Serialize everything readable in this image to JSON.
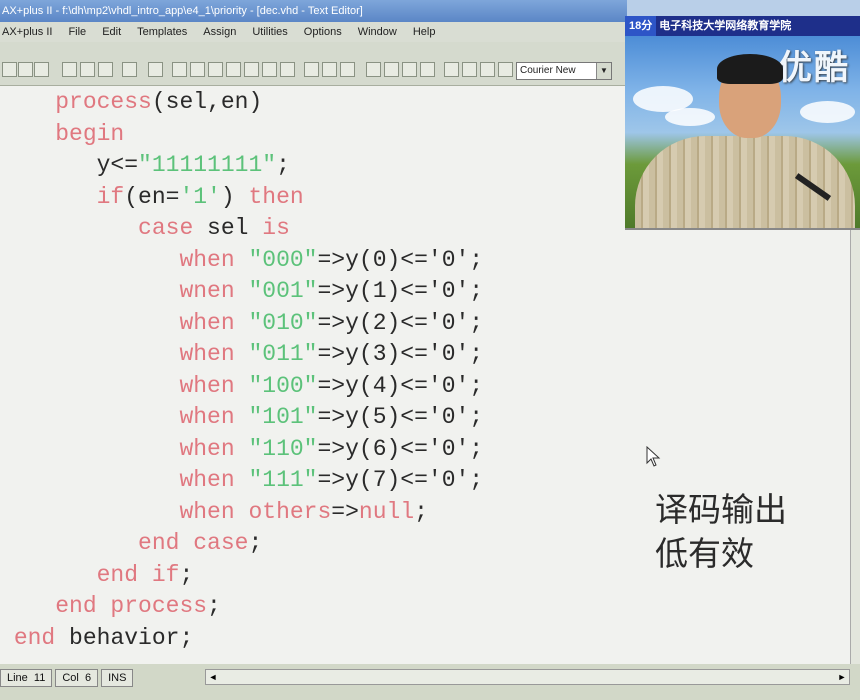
{
  "window": {
    "title": "AX+plus II - f:\\dh\\mp2\\vhdl_intro_app\\e4_1\\priority - [dec.vhd - Text Editor]"
  },
  "menu": {
    "items": [
      "AX+plus II",
      "File",
      "Edit",
      "Templates",
      "Assign",
      "Utilities",
      "Options",
      "Window",
      "Help"
    ]
  },
  "toolbar": {
    "font_name": "Courier New"
  },
  "video": {
    "timer": "18分",
    "channel": "电子科技大学网络教育学院",
    "logo": "优酷"
  },
  "editor": {
    "lines": [
      [
        {
          "t": "    "
        },
        {
          "t": "process",
          "c": "kw"
        },
        {
          "t": "(sel,en)"
        }
      ],
      [
        {
          "t": "    "
        },
        {
          "t": "begin",
          "c": "kw"
        }
      ],
      [
        {
          "t": "       y<="
        },
        {
          "t": "\"11111111\"",
          "c": "str"
        },
        {
          "t": ";"
        }
      ],
      [
        {
          "t": "       "
        },
        {
          "t": "if",
          "c": "kw"
        },
        {
          "t": "(en="
        },
        {
          "t": "'1'",
          "c": "str"
        },
        {
          "t": ") "
        },
        {
          "t": "then",
          "c": "kw"
        }
      ],
      [
        {
          "t": "          "
        },
        {
          "t": "case",
          "c": "kw"
        },
        {
          "t": " sel "
        },
        {
          "t": "is",
          "c": "kw"
        }
      ],
      [
        {
          "t": "             "
        },
        {
          "t": "when",
          "c": "kw"
        },
        {
          "t": " "
        },
        {
          "t": "\"000\"",
          "c": "str"
        },
        {
          "t": "=>y(0)<='0';"
        }
      ],
      [
        {
          "t": "             "
        },
        {
          "t": "wnen",
          "c": "kw"
        },
        {
          "t": " "
        },
        {
          "t": "\"001\"",
          "c": "str"
        },
        {
          "t": "=>y(1)<='0';"
        }
      ],
      [
        {
          "t": "             "
        },
        {
          "t": "when",
          "c": "kw"
        },
        {
          "t": " "
        },
        {
          "t": "\"010\"",
          "c": "str"
        },
        {
          "t": "=>y(2)<='0';"
        }
      ],
      [
        {
          "t": "             "
        },
        {
          "t": "when",
          "c": "kw"
        },
        {
          "t": " "
        },
        {
          "t": "\"011\"",
          "c": "str"
        },
        {
          "t": "=>y(3)<='0';"
        }
      ],
      [
        {
          "t": "             "
        },
        {
          "t": "when",
          "c": "kw"
        },
        {
          "t": " "
        },
        {
          "t": "\"100\"",
          "c": "str"
        },
        {
          "t": "=>y(4)<='0';"
        }
      ],
      [
        {
          "t": "             "
        },
        {
          "t": "when",
          "c": "kw"
        },
        {
          "t": " "
        },
        {
          "t": "\"101\"",
          "c": "str"
        },
        {
          "t": "=>y(5)<='0';"
        }
      ],
      [
        {
          "t": "             "
        },
        {
          "t": "when",
          "c": "kw"
        },
        {
          "t": " "
        },
        {
          "t": "\"110\"",
          "c": "str"
        },
        {
          "t": "=>y(6)<='0';"
        }
      ],
      [
        {
          "t": "             "
        },
        {
          "t": "when",
          "c": "kw"
        },
        {
          "t": " "
        },
        {
          "t": "\"111\"",
          "c": "str"
        },
        {
          "t": "=>y(7)<='0';"
        }
      ],
      [
        {
          "t": "             "
        },
        {
          "t": "when",
          "c": "kw"
        },
        {
          "t": " "
        },
        {
          "t": "others",
          "c": "kw"
        },
        {
          "t": "=>"
        },
        {
          "t": "null",
          "c": "kw"
        },
        {
          "t": ";"
        }
      ],
      [
        {
          "t": "          "
        },
        {
          "t": "end case",
          "c": "kw"
        },
        {
          "t": ";"
        }
      ],
      [
        {
          "t": "       "
        },
        {
          "t": "end if",
          "c": "kw"
        },
        {
          "t": ";"
        }
      ],
      [
        {
          "t": "    "
        },
        {
          "t": "end process",
          "c": "kw"
        },
        {
          "t": ";"
        }
      ],
      [
        {
          "t": " "
        },
        {
          "t": "end",
          "c": "kw"
        },
        {
          "t": " behavior;"
        }
      ]
    ],
    "annotation_line1": "译码输出",
    "annotation_line2": "低有效"
  },
  "status": {
    "line_label": "Line",
    "line_value": "11",
    "col_label": "Col",
    "col_value": "6",
    "mode": "INS"
  }
}
